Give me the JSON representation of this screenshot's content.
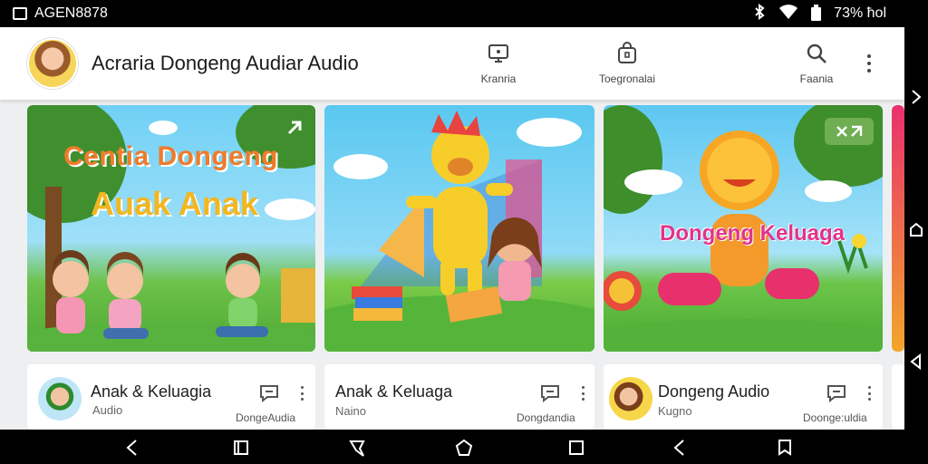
{
  "status_bar": {
    "app_name": "AGEN8878",
    "battery": "73% ħol"
  },
  "header": {
    "title": "Acraria Dongeng Audiar Audio"
  },
  "nav": [
    {
      "label": "Kranria",
      "icon": "tv-icon"
    },
    {
      "label": "Toegronalai",
      "icon": "bag-icon"
    },
    {
      "label": "Faania",
      "icon": "search-icon"
    }
  ],
  "cards": [
    {
      "thumb_title_line1": "Centia Dongeng",
      "thumb_title_line2": "Auak Anak",
      "title": "Anak & Keluagia",
      "subtitle": "Audio",
      "channel": "DongeAudia"
    },
    {
      "title": "Anak & Keluaga",
      "subtitle": "Naino",
      "channel": "Dongdandia"
    },
    {
      "thumb_title": "Dongeng Keluaga",
      "title": "Dongeng Audio",
      "subtitle": "Kugno",
      "channel": "Doonge:uldia"
    }
  ],
  "colors": {
    "accent_green": "#3a9d3a",
    "sky": "#5ec3ee",
    "grass": "#58b43a"
  }
}
